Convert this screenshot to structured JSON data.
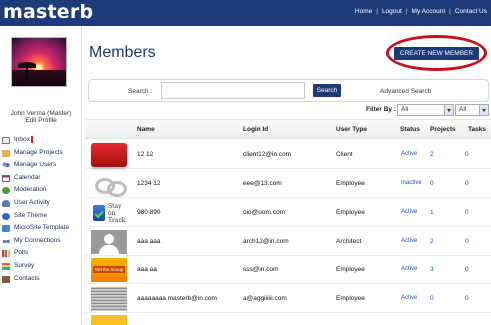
{
  "app": {
    "logo": "masterb",
    "nav": [
      "Home",
      "Logout",
      "My Account",
      "Contact Us"
    ],
    "nav_sep": "|"
  },
  "profile": {
    "name": "John Verma (Master)",
    "edit": "Edit Profile"
  },
  "menu": [
    {
      "label": "Inbox",
      "icon": "inbox-icon"
    },
    {
      "label": "Manage Projects",
      "icon": "folder-icon"
    },
    {
      "label": "Manage Users",
      "icon": "users-icon"
    },
    {
      "label": "Calendar",
      "icon": "calendar-icon"
    },
    {
      "label": "Moderation",
      "icon": "moderation-icon"
    },
    {
      "label": "User Activity",
      "icon": "user-activity-icon"
    },
    {
      "label": "Site Theme",
      "icon": "theme-icon"
    },
    {
      "label": "MicroSite Template",
      "icon": "microsite-icon"
    },
    {
      "label": "My Connections",
      "icon": "connections-icon"
    },
    {
      "label": "Polls",
      "icon": "polls-icon"
    },
    {
      "label": "Survey",
      "icon": "survey-icon"
    },
    {
      "label": "Contacts",
      "icon": "contacts-icon"
    }
  ],
  "page": {
    "title": "Members",
    "create_button": "CREATE NEW MEMBER",
    "highlight_color": "#c8101a"
  },
  "search": {
    "label": "Search :",
    "value": "",
    "button": "Search",
    "advanced": "Advanced Search"
  },
  "filter": {
    "label": "Filter By :",
    "select1": "All",
    "select2": "All"
  },
  "table": {
    "headers": [
      "Name",
      "Login Id",
      "User Type",
      "Status",
      "Projects",
      "Tasks"
    ],
    "rows": [
      {
        "name": "12 12",
        "login": "client12@in.com",
        "type": "Client",
        "status": "Active",
        "projects": "2",
        "tasks": "0"
      },
      {
        "name": "1234 12",
        "login": "eee@13.com",
        "type": "Employee",
        "status": "Inactive",
        "projects": "0",
        "tasks": "0"
      },
      {
        "name": "980 890",
        "login": "oio@uom.com",
        "type": "Employee",
        "status": "Active",
        "projects": "1",
        "tasks": "0"
      },
      {
        "name": "aaa aaa",
        "login": "arch12@in.com",
        "type": "Architect",
        "status": "Active",
        "projects": "2",
        "tasks": "0"
      },
      {
        "name": "aaa aa",
        "login": "sss@in.com",
        "type": "Employee",
        "status": "Active",
        "projects": "3",
        "tasks": "0"
      },
      {
        "name": "aaaaaaaa masterb@in.com",
        "login": "a@aggiiiiii.com",
        "type": "Employee",
        "status": "Active",
        "projects": "0",
        "tasks": "0"
      }
    ],
    "avatar_texts": {
      "track": "Stay on Track",
      "sign": "Get the Scoop"
    }
  },
  "colors": {
    "brand": "#1d3b78",
    "link": "#1f4fc4"
  }
}
